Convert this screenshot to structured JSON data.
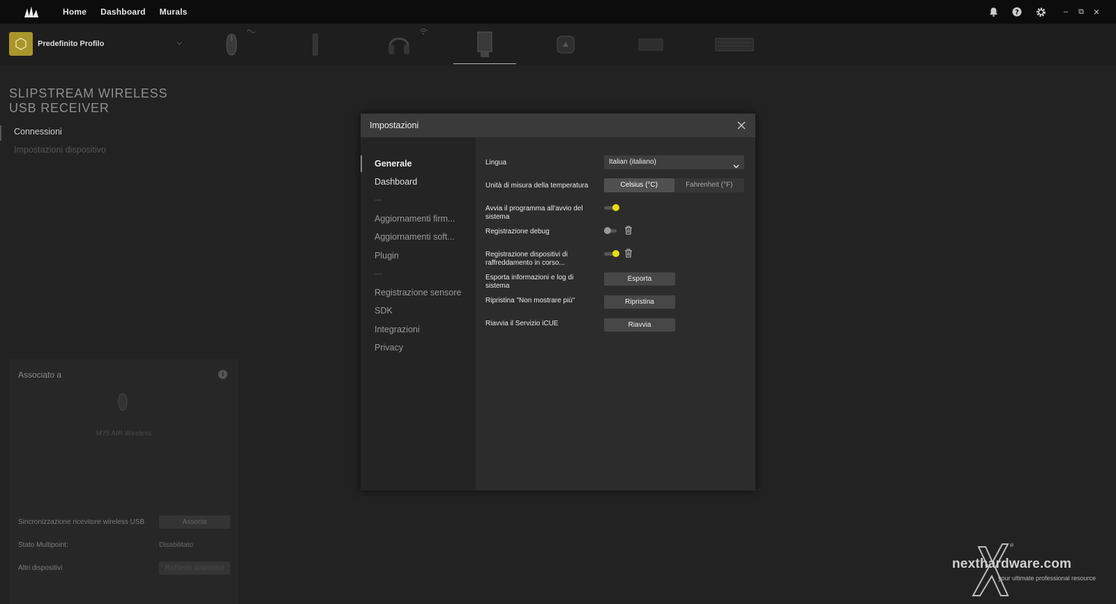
{
  "topbar": {
    "logo": "corsair-sails-logo",
    "nav": [
      "Home",
      "Dashboard",
      "Murals"
    ],
    "icons": [
      "bell-icon",
      "help-icon",
      "gear-icon"
    ],
    "window_controls": [
      "–",
      "⧉",
      "✕"
    ]
  },
  "profile": {
    "name": "Predefinito Profilo",
    "caret": "⌵"
  },
  "devices": [
    {
      "name": "mouse",
      "icon": "mouse-icon"
    },
    {
      "name": "usb-stick",
      "icon": "usb-stick-icon"
    },
    {
      "name": "headset",
      "icon": "headset-icon"
    },
    {
      "name": "usb-receiver",
      "icon": "usb-receiver-icon",
      "active": true
    },
    {
      "name": "controller",
      "icon": "controller-icon"
    },
    {
      "name": "pc-case",
      "icon": "case-icon"
    },
    {
      "name": "keyboard",
      "icon": "keyboard-icon"
    }
  ],
  "left": {
    "title_line1": "SLIPSTREAM WIRELESS",
    "title_line2": "USB RECEIVER",
    "nav": {
      "connections": "Connessioni",
      "device_settings": "Impostazioni dispositivo"
    }
  },
  "associated": {
    "title": "Associato a",
    "info": "i",
    "device_name": "M75 AIR Wireless",
    "rows": {
      "sync_label": "Sincronizzazione ricevitore wireless USB",
      "sync_button": "Associa",
      "multipoint_label": "Stato Multipoint:",
      "multipoint_value": "Disabilitato",
      "other_label": "Altri dispositivi",
      "other_button": "Richiede dispositivi"
    }
  },
  "modal": {
    "title": "Impostazioni",
    "sidebar": {
      "general": "Generale",
      "dashboard": "Dashboard",
      "sep1": "—",
      "firmware": "Aggiornamenti firm...",
      "software": "Aggiornamenti soft...",
      "plugin": "Plugin",
      "sep2": "—",
      "sensor_log": "Registrazione sensore",
      "sdk": "SDK",
      "integrations": "Integrazioni",
      "privacy": "Privacy"
    },
    "settings": {
      "language_label": "Lingua",
      "language_value": "Italian (italiano)",
      "temp_label": "Unità di misura della temperatura",
      "temp_celsius": "Celsius (°C)",
      "temp_fahrenheit": "Fahrenheit (°F)",
      "startup_label": "Avvia il programma all'avvio del sistema",
      "startup_on": true,
      "debug_label": "Registrazione debug",
      "debug_on": false,
      "cooling_label": "Registrazione dispositivi di raffreddamento in corso...",
      "cooling_on": true,
      "export_label": "Esporta informazioni e log di sistema",
      "export_button": "Esporta",
      "reset_label": "Ripristina \"Non mostrare più\"",
      "reset_button": "Ripristina",
      "restart_label": "Riavvia il Servizio iCUE",
      "restart_button": "Riavvia"
    }
  },
  "watermark": {
    "brand": "nexthardware.com",
    "tagline": "your ultimate professional resource",
    "registered": "®"
  },
  "colors": {
    "accent_yellow": "#e6dc12",
    "profile_gold": "#a8962a"
  }
}
